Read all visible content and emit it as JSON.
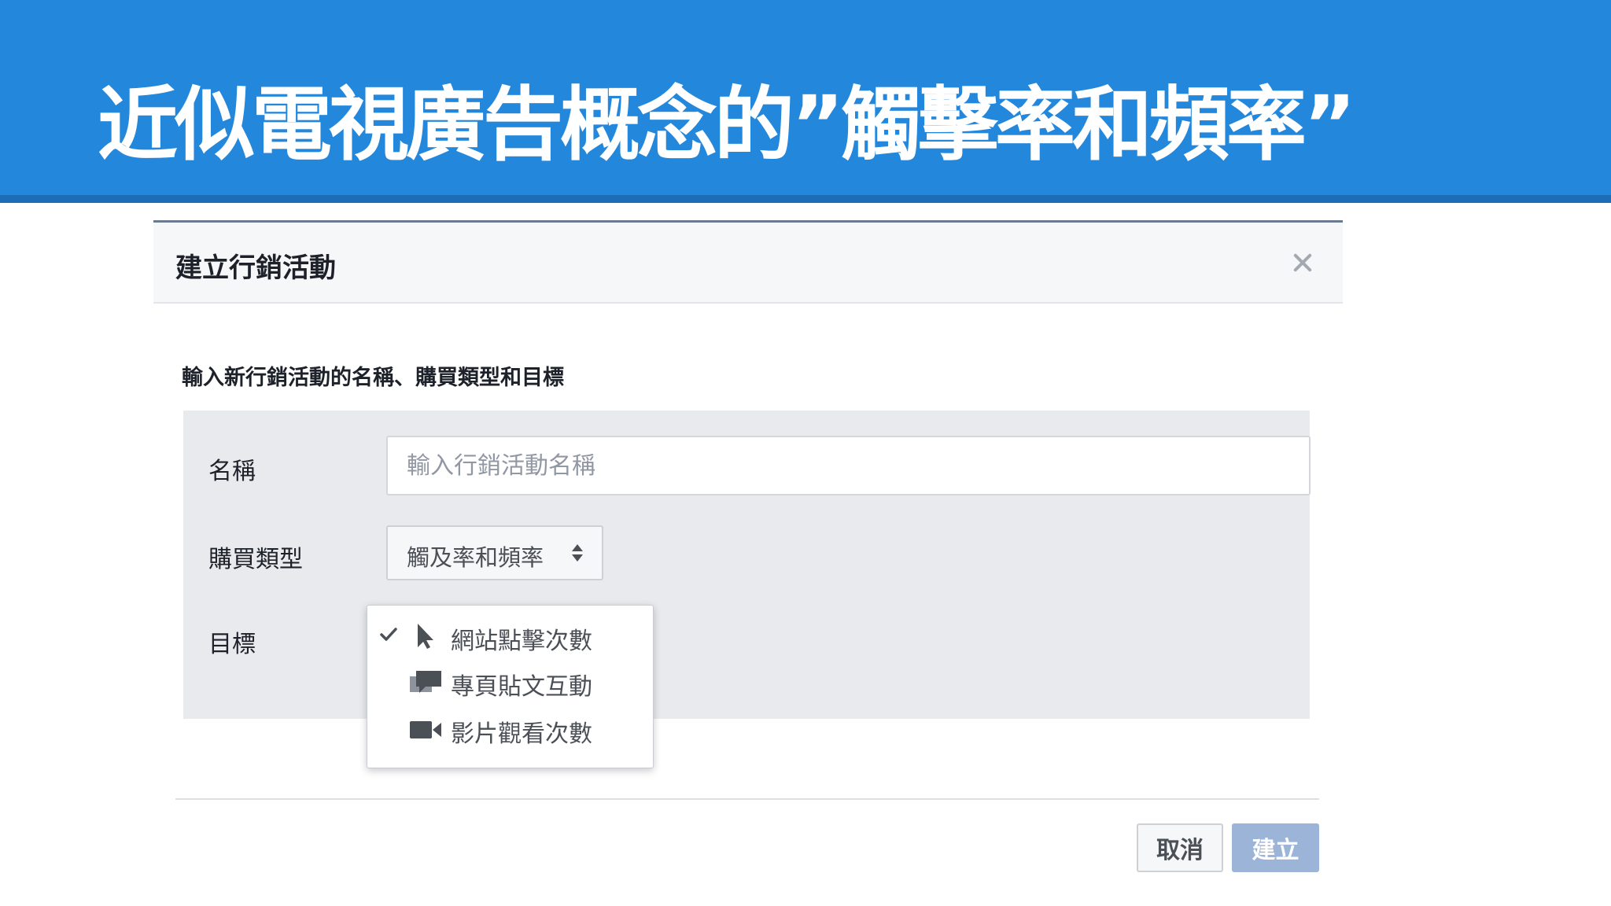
{
  "slide": {
    "title": "近似電視廣告概念的”觸擊率和頻率”",
    "banner_color": "#2387dc"
  },
  "dialog": {
    "title": "建立行銷活動",
    "close_icon": "close-icon",
    "instruction": "輸入新行銷活動的名稱、購買類型和目標",
    "fields": {
      "name_label": "名稱",
      "name_value": "",
      "name_placeholder": "輸入行銷活動名稱",
      "buying_type_label": "購買類型",
      "buying_type_value": "觸及率和頻率",
      "objective_label": "目標"
    },
    "objective_menu": [
      {
        "label": "網站點擊次數",
        "icon": "cursor-icon",
        "selected": true
      },
      {
        "label": "專頁貼文互動",
        "icon": "posts-icon",
        "selected": false
      },
      {
        "label": "影片觀看次數",
        "icon": "video-camera-icon",
        "selected": false
      }
    ],
    "buttons": {
      "cancel": "取消",
      "create": "建立"
    }
  },
  "colors": {
    "primary_disabled": "#9cb4d8",
    "panel_bg": "#e9eaed"
  }
}
